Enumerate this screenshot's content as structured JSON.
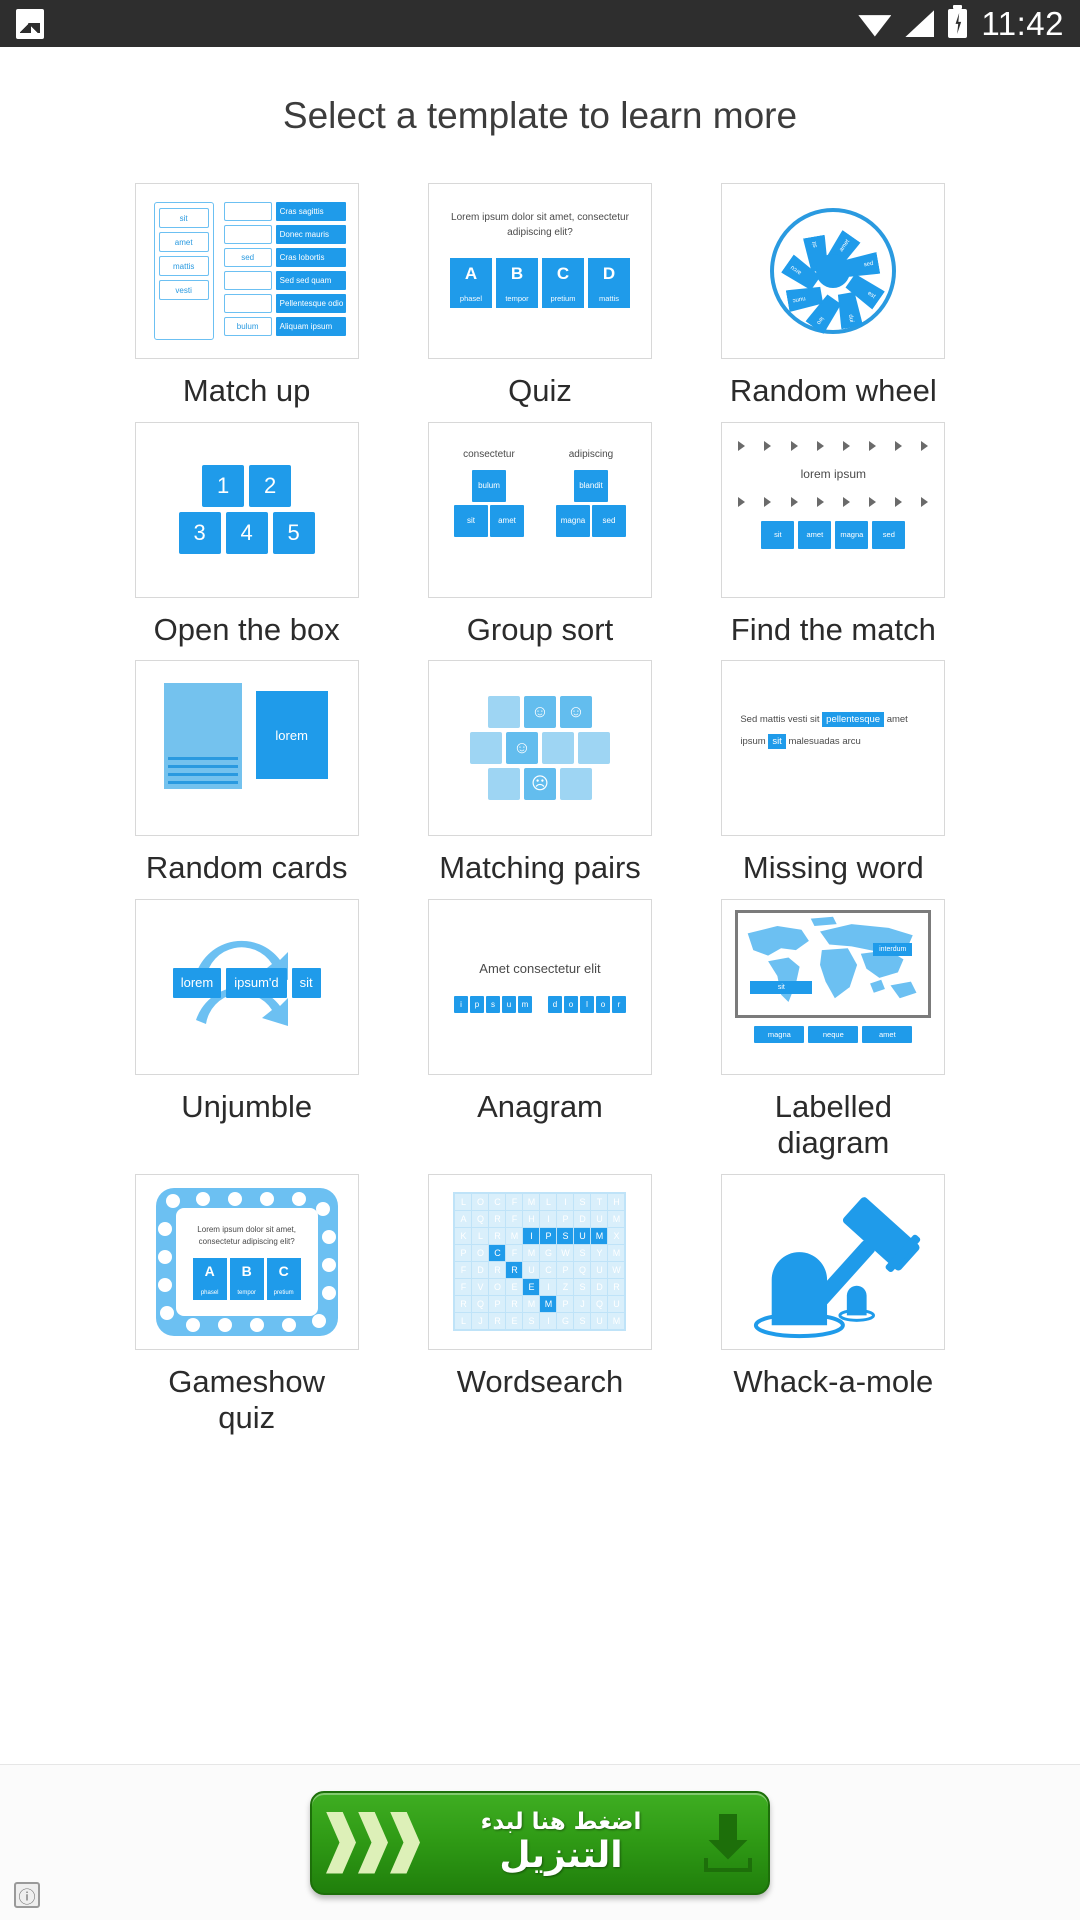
{
  "statusbar": {
    "time": "11:42",
    "icons": [
      "image-icon",
      "wifi-icon",
      "signal-icon",
      "battery-charging-icon"
    ]
  },
  "header": {
    "title": "Select a template to learn more"
  },
  "templates": [
    {
      "id": "match-up",
      "label": "Match up",
      "thumb": {
        "left_items": [
          "sit",
          "amet",
          "mattis",
          "vesti"
        ],
        "right_blanks": [
          "",
          "",
          "sed",
          "",
          "",
          "bulum"
        ],
        "right_items": [
          "Cras sagittis",
          "Donec mauris",
          "Cras lobortis",
          "Sed sed quam",
          "Pellentesque odio",
          "Aliquam ipsum"
        ]
      }
    },
    {
      "id": "quiz",
      "label": "Quiz",
      "thumb": {
        "question": "Lorem ipsum dolor sit amet, consectetur adipiscing elit?",
        "options": [
          {
            "letter": "A",
            "text": "phasel"
          },
          {
            "letter": "B",
            "text": "tempor"
          },
          {
            "letter": "C",
            "text": "pretium"
          },
          {
            "letter": "D",
            "text": "mattis"
          }
        ]
      }
    },
    {
      "id": "random-wheel",
      "label": "Random wheel",
      "thumb": {
        "segments": [
          "sit",
          "amet",
          "sed",
          "est",
          "dui",
          "leo",
          "nunc",
          "arcu"
        ]
      }
    },
    {
      "id": "open-the-box",
      "label": "Open the box",
      "thumb": {
        "row1": [
          "1",
          "2"
        ],
        "row2": [
          "3",
          "4",
          "5"
        ]
      }
    },
    {
      "id": "group-sort",
      "label": "Group sort",
      "thumb": {
        "groups": [
          {
            "title": "consectetur",
            "top": "bulum",
            "bottom": [
              "sit",
              "amet"
            ]
          },
          {
            "title": "adipiscing",
            "top": "blandit",
            "bottom": [
              "magna",
              "sed"
            ]
          }
        ]
      }
    },
    {
      "id": "find-the-match",
      "label": "Find the match",
      "thumb": {
        "prompt": "lorem ipsum",
        "tiles": [
          "sit",
          "amet",
          "magna",
          "sed"
        ],
        "arrow_count": 8
      }
    },
    {
      "id": "random-cards",
      "label": "Random cards",
      "thumb": {
        "front_text": "lorem"
      }
    },
    {
      "id": "matching-pairs",
      "label": "Matching pairs",
      "thumb": {
        "faces": [
          "☺",
          "☺",
          "☺",
          "☹"
        ]
      }
    },
    {
      "id": "missing-word",
      "label": "Missing word",
      "thumb": {
        "line1_before": "Sed mattis vesti sit",
        "line1_blank": "pellentesque",
        "line1_after": "amet",
        "line2_before": "ipsum",
        "line2_blank": "sit",
        "line2_after": "malesuadas arcu"
      }
    },
    {
      "id": "unjumble",
      "label": "Unjumble",
      "thumb": {
        "tiles": [
          "lorem",
          "ipsum'd",
          "sit"
        ]
      }
    },
    {
      "id": "anagram",
      "label": "Anagram",
      "thumb": {
        "title": "Amet consectetur elit",
        "word1": [
          "i",
          "p",
          "s",
          "u",
          "m"
        ],
        "word2": [
          "d",
          "o",
          "l",
          "o",
          "r"
        ]
      }
    },
    {
      "id": "labelled-diagram",
      "label": "Labelled diagram",
      "thumb": {
        "map_labels": [
          "interdum",
          "sit"
        ],
        "tiles": [
          "magna",
          "neque",
          "amet"
        ]
      }
    },
    {
      "id": "gameshow-quiz",
      "label": "Gameshow quiz",
      "thumb": {
        "question": "Lorem ipsum dolor sit amet, consectetur adipiscing elit?",
        "options": [
          {
            "letter": "A",
            "text": "phasel"
          },
          {
            "letter": "B",
            "text": "tempor"
          },
          {
            "letter": "C",
            "text": "pretium"
          }
        ]
      }
    },
    {
      "id": "wordsearch",
      "label": "Wordsearch",
      "thumb": {
        "rows": [
          "LOCFMLISTH",
          "AQRFHIPDUM",
          "KLRMIPSUMX",
          "POCFMGWSYM",
          "FDRRUCPQUW",
          "FVOEEIZSDR",
          "RQPRMMPJQU",
          "LJRESIGSUM"
        ]
      }
    },
    {
      "id": "whack-a-mole",
      "label": "Whack-a-mole",
      "thumb": {}
    }
  ],
  "ad": {
    "line1": "اضغط هنا لبدء",
    "line2": "التنزيل",
    "info_glyph": "ⓘ",
    "bg_color": "#2f9a15"
  },
  "colors": {
    "accent": "#1f9bea",
    "accent_light": "#6cc0f2",
    "status_bar": "#2e2e2e",
    "text": "#2b2b2b"
  }
}
